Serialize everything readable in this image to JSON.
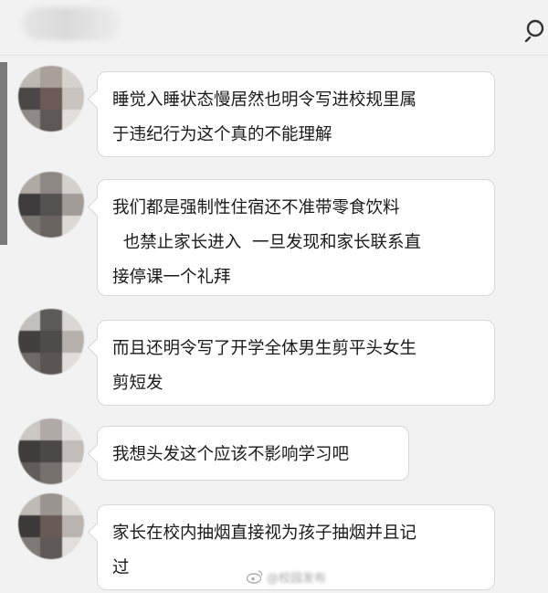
{
  "header": {
    "search_icon": "search-icon"
  },
  "messages": [
    {
      "text": "睡觉入睡状态慢居然也明令写进校规里属\n于违纪行为这个真的不能理解"
    },
    {
      "text": "我们都是强制性住宿还不准带零食饮料\n  也禁止家长进入  一旦发现和家长联系直\n接停课一个礼拜"
    },
    {
      "text": "而且还明令写了开学全体男生剪平头女生\n剪短发"
    },
    {
      "text": "我想头发这个应该不影响学习吧"
    },
    {
      "text": "家长在校内抽烟直接视为孩子抽烟并且记\n过"
    }
  ],
  "watermark": {
    "icon": "weibo-icon",
    "text": "@校园发布"
  },
  "colors": {
    "background": "#f2f2f2",
    "bubble": "#ffffff",
    "bubble_border": "#d7d7d7",
    "text": "#1a1a1a"
  }
}
